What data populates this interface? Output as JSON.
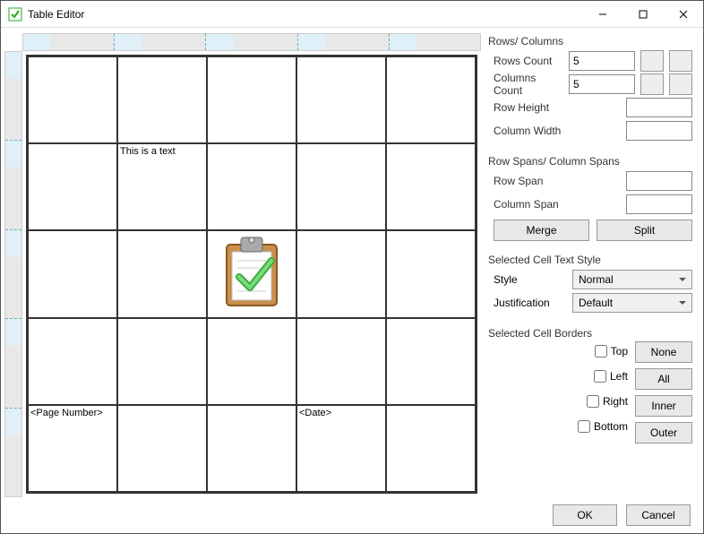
{
  "window": {
    "title": "Table Editor"
  },
  "table": {
    "cells": {
      "r1c1_text": "This is a text",
      "r4c0_text": "<Page Number>",
      "r4c3_text": "<Date>"
    }
  },
  "rowsColumns": {
    "section_title": "Rows/ Columns",
    "rows_count_label": "Rows Count",
    "rows_count_value": "5",
    "cols_count_label": "Columns Count",
    "cols_count_value": "5",
    "row_height_label": "Row Height",
    "row_height_value": "",
    "col_width_label": "Column Width",
    "col_width_value": ""
  },
  "spans": {
    "section_title": "Row Spans/ Column Spans",
    "row_span_label": "Row Span",
    "row_span_value": "",
    "col_span_label": "Column Span",
    "col_span_value": "",
    "merge_label": "Merge",
    "split_label": "Split"
  },
  "textStyle": {
    "section_title": "Selected Cell Text Style",
    "style_label": "Style",
    "style_value": "Normal",
    "justification_label": "Justification",
    "justification_value": "Default"
  },
  "borders": {
    "section_title": "Selected Cell Borders",
    "top_label": "Top",
    "left_label": "Left",
    "right_label": "Right",
    "bottom_label": "Bottom",
    "none_label": "None",
    "all_label": "All",
    "inner_label": "Inner",
    "outer_label": "Outer"
  },
  "footer": {
    "ok_label": "OK",
    "cancel_label": "Cancel"
  }
}
